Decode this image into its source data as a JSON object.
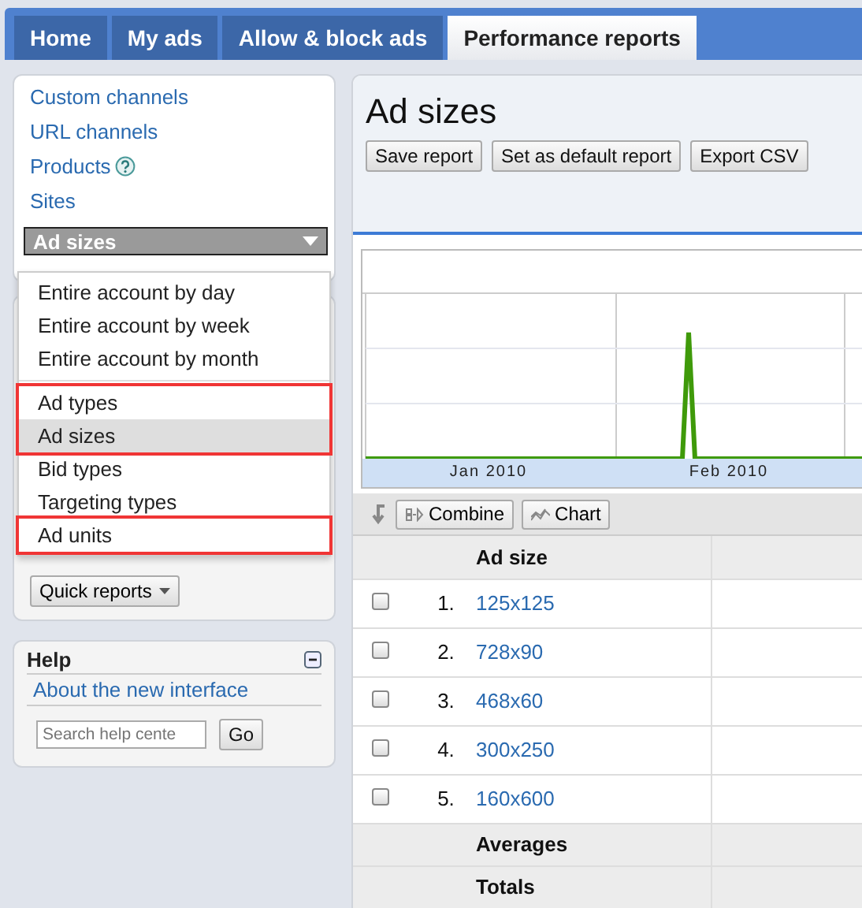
{
  "tabs": [
    {
      "label": "Home",
      "selected": false
    },
    {
      "label": "My ads",
      "selected": false
    },
    {
      "label": "Allow & block ads",
      "selected": false
    },
    {
      "label": "Performance reports",
      "selected": true
    }
  ],
  "sidebar": {
    "links": [
      {
        "label": "Custom channels",
        "help": false
      },
      {
        "label": "URL channels",
        "help": false
      },
      {
        "label": "Products",
        "help": true
      },
      {
        "label": "Sites",
        "help": false
      }
    ],
    "report_select": {
      "value": "Ad sizes",
      "expanded": true
    },
    "quick_reports": "Quick reports",
    "menu": [
      {
        "outlined": false,
        "divider_after": true,
        "items": [
          {
            "label": "Entire account by day",
            "selected": false
          },
          {
            "label": "Entire account by week",
            "selected": false
          },
          {
            "label": "Entire account by month",
            "selected": false
          }
        ]
      },
      {
        "outlined": true,
        "divider_after": false,
        "items": [
          {
            "label": "Ad types",
            "selected": false
          },
          {
            "label": "Ad sizes",
            "selected": true
          }
        ]
      },
      {
        "outlined": false,
        "divider_after": false,
        "items": [
          {
            "label": "Bid types",
            "selected": false
          },
          {
            "label": "Targeting types",
            "selected": false
          }
        ]
      },
      {
        "outlined": true,
        "divider_after": false,
        "items": [
          {
            "label": "Ad units",
            "selected": false
          }
        ]
      }
    ]
  },
  "help": {
    "title": "Help",
    "link": "About the new interface",
    "search": {
      "placeholder": "Search help cente"
    },
    "go": "Go"
  },
  "report": {
    "title": "Ad sizes",
    "buttons": [
      "Save report",
      "Set as default report",
      "Export CSV"
    ],
    "chart_labels": [
      "Jan 2010",
      "Feb 2010"
    ],
    "toolbar": [
      "Combine",
      "Chart"
    ],
    "table": {
      "header": "Ad size",
      "rows": [
        {
          "n": "1.",
          "size": "125x125",
          "checked": false
        },
        {
          "n": "2.",
          "size": "728x90",
          "checked": false
        },
        {
          "n": "3.",
          "size": "468x60",
          "checked": false
        },
        {
          "n": "4.",
          "size": "300x250",
          "checked": false
        },
        {
          "n": "5.",
          "size": "160x600",
          "checked": false
        }
      ],
      "summary": [
        "Averages",
        "Totals"
      ]
    }
  }
}
